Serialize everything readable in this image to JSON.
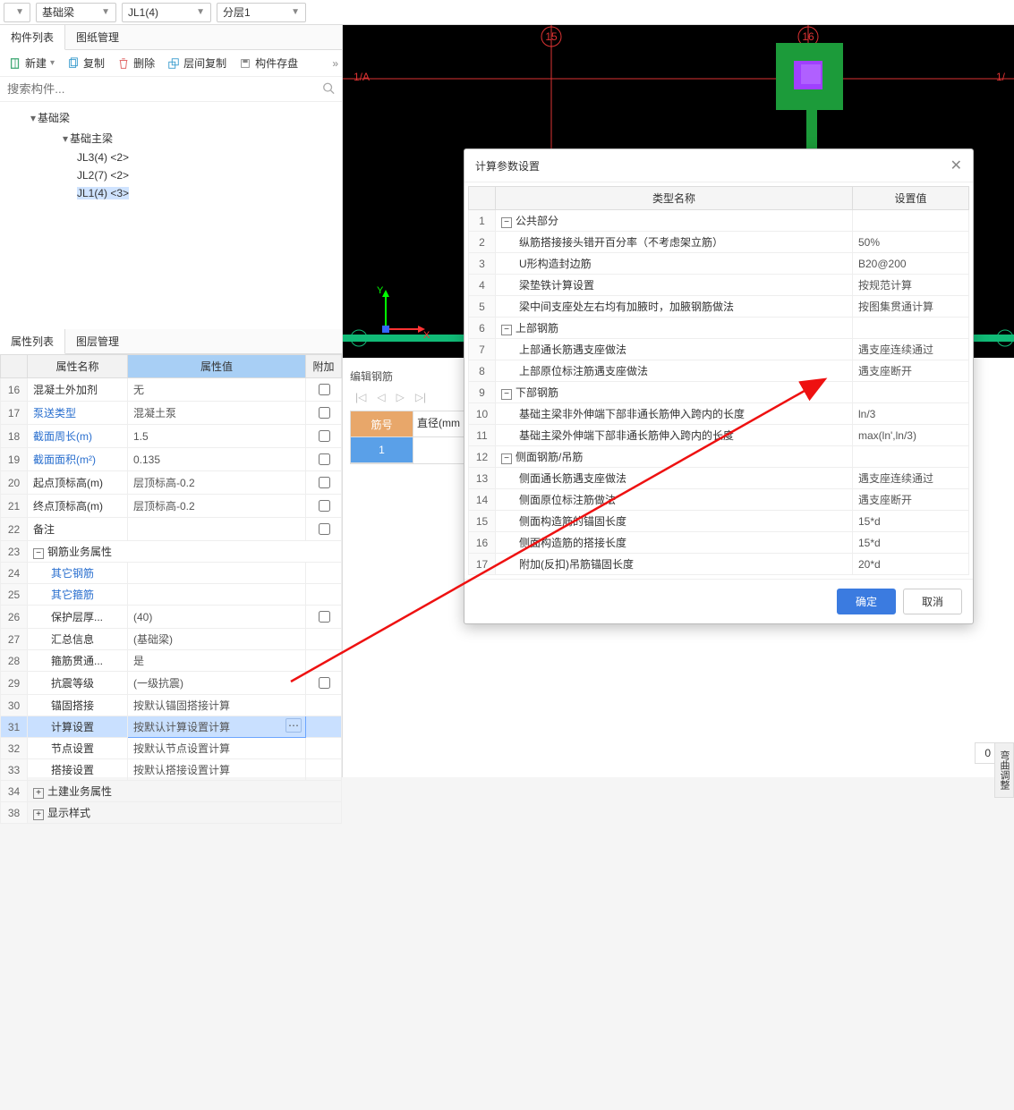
{
  "topbar": {
    "dd1": "",
    "dd2": "基础梁",
    "dd3": "JL1(4)",
    "dd4": "分层1"
  },
  "panels": {
    "component_list": "构件列表",
    "drawing_mgmt": "图纸管理",
    "layer_mgmt": "图层管理"
  },
  "toolbar": {
    "new": "新建",
    "copy": "复制",
    "delete": "删除",
    "layer_copy": "层间复制",
    "save_component": "构件存盘"
  },
  "search": {
    "placeholder": "搜索构件..."
  },
  "tree": {
    "l1": "基础梁",
    "l2": "基础主梁",
    "items": [
      "JL3(4) <2>",
      "JL2(7) <2>",
      "JL1(4) <3>"
    ]
  },
  "prop": {
    "tabs": [
      "属性列表",
      "图层管理"
    ],
    "header": {
      "name": "属性名称",
      "val": "属性值",
      "extra": "附加"
    },
    "rows": [
      {
        "i": "16",
        "n": "混凝土外加剂",
        "v": "无",
        "ck": false,
        "link": false
      },
      {
        "i": "17",
        "n": "泵送类型",
        "v": "混凝土泵",
        "ck": false,
        "link": true
      },
      {
        "i": "18",
        "n": "截面周长(m)",
        "v": "1.5",
        "ck": true,
        "link": true
      },
      {
        "i": "19",
        "n": "截面面积(m²)",
        "v": "0.135",
        "ck": true,
        "link": true
      },
      {
        "i": "20",
        "n": "起点顶标高(m)",
        "v": "层顶标高-0.2",
        "ck": false,
        "link": false
      },
      {
        "i": "21",
        "n": "终点顶标高(m)",
        "v": "层顶标高-0.2",
        "ck": false,
        "link": false
      },
      {
        "i": "22",
        "n": "备注",
        "v": "",
        "ck": false,
        "link": false
      },
      {
        "i": "23",
        "n": "钢筋业务属性",
        "v": "",
        "ck": false,
        "group": true
      },
      {
        "i": "24",
        "n": "其它钢筋",
        "v": "",
        "ck": false,
        "link": true,
        "indent": true
      },
      {
        "i": "25",
        "n": "其它箍筋",
        "v": "",
        "ck": false,
        "link": true,
        "indent": true
      },
      {
        "i": "26",
        "n": "保护层厚...",
        "v": "(40)",
        "ck": true,
        "link": false,
        "indent": true
      },
      {
        "i": "27",
        "n": "汇总信息",
        "v": "(基础梁)",
        "ck": false,
        "link": false,
        "indent": true
      },
      {
        "i": "28",
        "n": "箍筋贯通...",
        "v": "是",
        "ck": false,
        "link": false,
        "indent": true
      },
      {
        "i": "29",
        "n": "抗震等级",
        "v": "(一级抗震)",
        "ck": true,
        "link": false,
        "indent": true
      },
      {
        "i": "30",
        "n": "锚固搭接",
        "v": "按默认锚固搭接计算",
        "ck": false,
        "link": false,
        "indent": true
      },
      {
        "i": "31",
        "n": "计算设置",
        "v": "按默认计算设置计算",
        "ck": false,
        "link": false,
        "indent": true,
        "sel": true
      },
      {
        "i": "32",
        "n": "节点设置",
        "v": "按默认节点设置计算",
        "ck": false,
        "link": false,
        "indent": true
      },
      {
        "i": "33",
        "n": "搭接设置",
        "v": "按默认搭接设置计算",
        "ck": false,
        "link": false,
        "indent": true
      },
      {
        "i": "34",
        "n": "土建业务属性",
        "v": "",
        "ck": false,
        "group": true,
        "collapsed": true
      },
      {
        "i": "38",
        "n": "显示样式",
        "v": "",
        "ck": false,
        "group": true,
        "collapsed": true
      }
    ]
  },
  "viewport": {
    "axis_labels": {
      "y": "Y",
      "x": "X"
    },
    "grid_labels": {
      "a": "1/A",
      "a2": "A",
      "g15": "15",
      "g16": "16",
      "one": "1/"
    }
  },
  "rebar_panel": {
    "title": "编辑钢筋",
    "col1": "筋号",
    "col2": "直径(mm"
  },
  "right_side": {
    "zero": "0",
    "tab": "弯曲调整"
  },
  "modal": {
    "title": "计算参数设置",
    "head_type": "类型名称",
    "head_val": "设置值",
    "rows": [
      {
        "i": "1",
        "n": "公共部分",
        "v": "",
        "grp": true
      },
      {
        "i": "2",
        "n": "纵筋搭接接头错开百分率（不考虑架立筋）",
        "v": "50%",
        "indent": 1
      },
      {
        "i": "3",
        "n": "U形构造封边筋",
        "v": "B20@200",
        "indent": 1
      },
      {
        "i": "4",
        "n": "梁垫铁计算设置",
        "v": "按规范计算",
        "indent": 1
      },
      {
        "i": "5",
        "n": "梁中间支座处左右均有加腋时，加腋钢筋做法",
        "v": "按图集贯通计算",
        "indent": 1
      },
      {
        "i": "6",
        "n": "上部钢筋",
        "v": "",
        "grp": true
      },
      {
        "i": "7",
        "n": "上部通长筋遇支座做法",
        "v": "遇支座连续通过",
        "indent": 1
      },
      {
        "i": "8",
        "n": "上部原位标注筋遇支座做法",
        "v": "遇支座断开",
        "indent": 1
      },
      {
        "i": "9",
        "n": "下部钢筋",
        "v": "",
        "grp": true
      },
      {
        "i": "10",
        "n": "基础主梁非外伸端下部非通长筋伸入跨内的长度",
        "v": "ln/3",
        "indent": 1
      },
      {
        "i": "11",
        "n": "基础主梁外伸端下部非通长筋伸入跨内的长度",
        "v": "max(ln',ln/3)",
        "indent": 1
      },
      {
        "i": "12",
        "n": "侧面钢筋/吊筋",
        "v": "",
        "grp": true
      },
      {
        "i": "13",
        "n": "侧面通长筋遇支座做法",
        "v": "遇支座连续通过",
        "indent": 1
      },
      {
        "i": "14",
        "n": "侧面原位标注筋做法",
        "v": "遇支座断开",
        "indent": 1
      },
      {
        "i": "15",
        "n": "侧面构造筋的锚固长度",
        "v": "15*d",
        "indent": 1
      },
      {
        "i": "16",
        "n": "侧面构造筋的搭接长度",
        "v": "15*d",
        "indent": 1
      },
      {
        "i": "17",
        "n": "附加(反扣)吊筋锚固长度",
        "v": "20*d",
        "indent": 1
      }
    ],
    "ok": "确定",
    "cancel": "取消"
  }
}
